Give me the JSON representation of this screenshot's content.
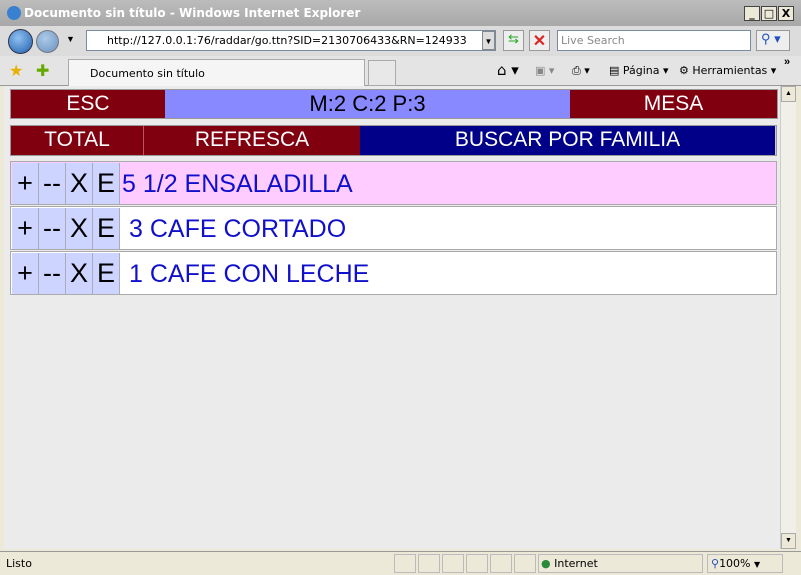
{
  "window": {
    "title": "Documento sin título - Windows Internet Explorer",
    "address": "http://127.0.0.1:76/raddar/go.ttn?SID=2130706433&RN=124933",
    "search_placeholder": "Live Search",
    "tab_title": "Documento sin título",
    "pagina": "Página",
    "herramientas": "Herramientas",
    "status": "Listo",
    "zone": "Internet",
    "zoom": "100%"
  },
  "header": {
    "esc": "ESC",
    "info": "M:2 C:2 P:3",
    "mesa": "MESA",
    "total": "TOTAL",
    "refresca": "REFRESCA",
    "buscar": "BUSCAR POR FAMILIA"
  },
  "buttons": {
    "plus": "+",
    "minus": "--",
    "delete": "X",
    "edit": "E"
  },
  "items": [
    {
      "text": "5 1/2 ENSALADILLA",
      "selected": true
    },
    {
      "text": "3 CAFE CORTADO",
      "selected": false
    },
    {
      "text": "1 CAFE CON LECHE",
      "selected": false
    }
  ],
  "colors": {
    "dark_red": "#800010",
    "blue_info": "#8888ff",
    "navy": "#000088",
    "selected_row": "#ffccff",
    "item_text": "#1010cc"
  }
}
